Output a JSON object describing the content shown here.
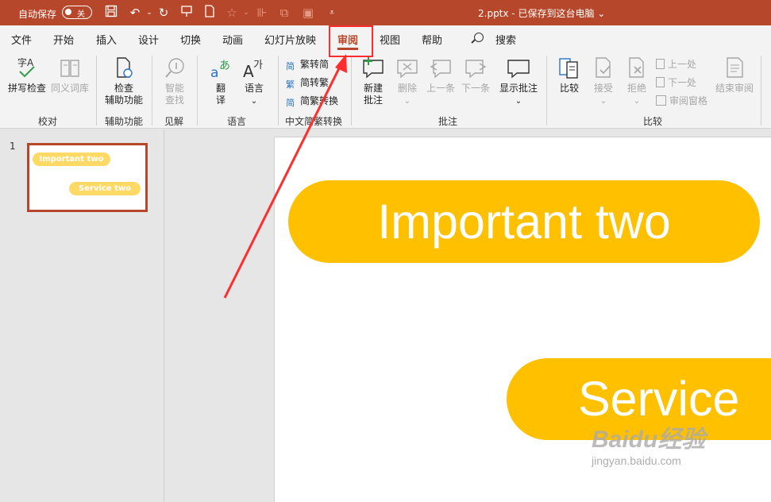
{
  "titlebar": {
    "autosave_label": "自动保存",
    "autosave_state": "关",
    "doc_title": "2.pptx - 已保存到这台电脑 ⌄",
    "background": "#b7472a"
  },
  "tabs": [
    "文件",
    "开始",
    "插入",
    "设计",
    "切换",
    "动画",
    "幻灯片放映",
    "审阅",
    "视图",
    "帮助"
  ],
  "active_tab": "审阅",
  "search_label": "搜索",
  "ribbon": {
    "proofing": {
      "spell_check": "拼写检查",
      "thesaurus": "同义词库",
      "group": "校对"
    },
    "accessibility": {
      "check_line1": "检查",
      "check_line2": "辅助功能",
      "group": "辅助功能"
    },
    "insights": {
      "smart_line1": "智能",
      "smart_line2": "查找",
      "group": "见解"
    },
    "language": {
      "translate_line1": "翻",
      "translate_line2": "译",
      "language": "语言",
      "group": "语言"
    },
    "chinese_conversion": {
      "t2s": "繁转简",
      "s2t": "简转繁",
      "convert": "简繁转换",
      "group": "中文简繁转换"
    },
    "comments": {
      "new_line1": "新建",
      "new_line2": "批注",
      "delete": "删除",
      "previous": "上一条",
      "next": "下一条",
      "show_comments": "显示批注",
      "group": "批注"
    },
    "compare": {
      "compare": "比较",
      "accept": "接受",
      "reject": "拒绝",
      "prev_change": "上一处",
      "next_change": "下一处",
      "reviewing_pane": "审阅窗格",
      "end_review": "结束审阅",
      "group": "比较"
    }
  },
  "thumbnail": {
    "slide_number": "1",
    "pill1": "Important two",
    "pill2": "Service  two"
  },
  "slide": {
    "pill1": "Important two",
    "pill2": "Service",
    "pill_color": "#ffc000"
  },
  "watermark": {
    "brand": "Baidu经验",
    "url": "jingyan.baidu.com"
  },
  "annotation_color": "#ff2d2d"
}
